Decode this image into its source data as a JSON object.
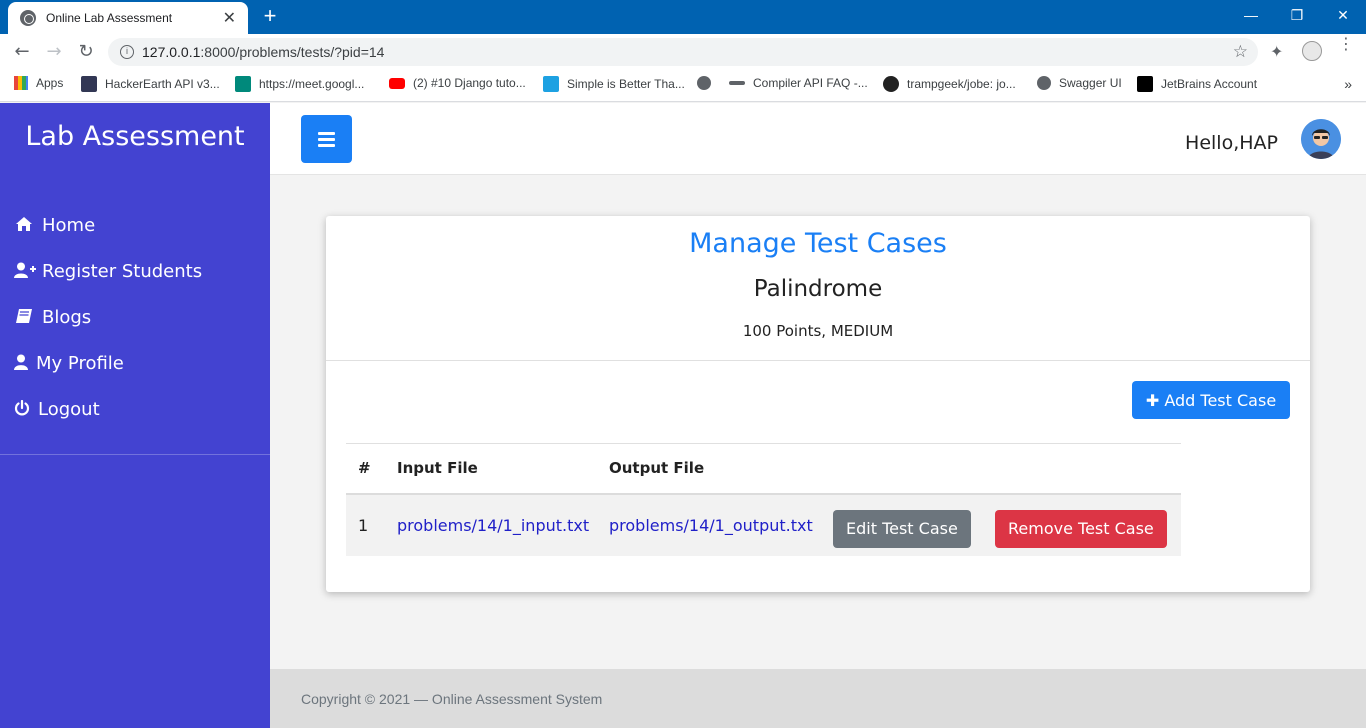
{
  "browser": {
    "tab_title": "Online Lab Assessment",
    "tab_close": "✕",
    "new_tab": "+",
    "minimize": "—",
    "restore": "❐",
    "close": "✕",
    "url_host": "127.0.0.1",
    "url_rest": ":8000/problems/tests/?pid=14",
    "bookmarks": [
      {
        "label": "Apps",
        "icon": "apps-grid-icon",
        "color": "#e8453c"
      },
      {
        "label": "HackerEarth API v3...",
        "icon": "hackerearth-icon",
        "color": "#323754"
      },
      {
        "label": "https://meet.googl...",
        "icon": "google-meet-icon",
        "color": "#00897b"
      },
      {
        "label": "(2) #10 Django tuto...",
        "icon": "youtube-icon",
        "color": "#ff0000"
      },
      {
        "label": "Simple is Better Tha...",
        "icon": "simple-is-better-icon",
        "color": "#1da1e2"
      },
      {
        "label": "",
        "icon": "globe-icon",
        "color": "#5f6368"
      },
      {
        "label": "Compiler API FAQ -...",
        "icon": "compiler-icon",
        "color": "#5f6368"
      },
      {
        "label": "trampgeek/jobe: jo...",
        "icon": "github-icon",
        "color": "#222222"
      },
      {
        "label": "Swagger UI",
        "icon": "globe-icon",
        "color": "#5f6368"
      },
      {
        "label": "JetBrains Account",
        "icon": "jetbrains-icon",
        "color": "#000000"
      }
    ],
    "bookmarks_more": "»"
  },
  "sidebar": {
    "brand": "Lab Assessment",
    "items": [
      {
        "label": "Home",
        "icon": "home-icon"
      },
      {
        "label": "Register Students",
        "icon": "user-plus-icon"
      },
      {
        "label": "Blogs",
        "icon": "book-icon"
      },
      {
        "label": "My Profile",
        "icon": "user-icon"
      },
      {
        "label": "Logout",
        "icon": "power-icon"
      }
    ]
  },
  "topbar": {
    "greeting": "Hello,HAP"
  },
  "card": {
    "title": "Manage Test Cases",
    "problem_name": "Palindrome",
    "meta": "100 Points, MEDIUM",
    "add_button": "Add Test Case",
    "table": {
      "headers": [
        "#",
        "Input File",
        "Output File",
        "",
        ""
      ],
      "rows": [
        {
          "num": "1",
          "input_file": "problems/14/1_input.txt",
          "output_file": "problems/14/1_output.txt",
          "edit_label": "Edit Test Case",
          "remove_label": "Remove Test Case"
        }
      ]
    }
  },
  "footer": {
    "text": "Copyright © 2021 — Online Assessment System"
  },
  "colors": {
    "sidebar": "#4343d1",
    "primary": "#1a7ff5",
    "secondary": "#6c757d",
    "danger": "#dc3545",
    "browser_frame": "#0062b1"
  }
}
